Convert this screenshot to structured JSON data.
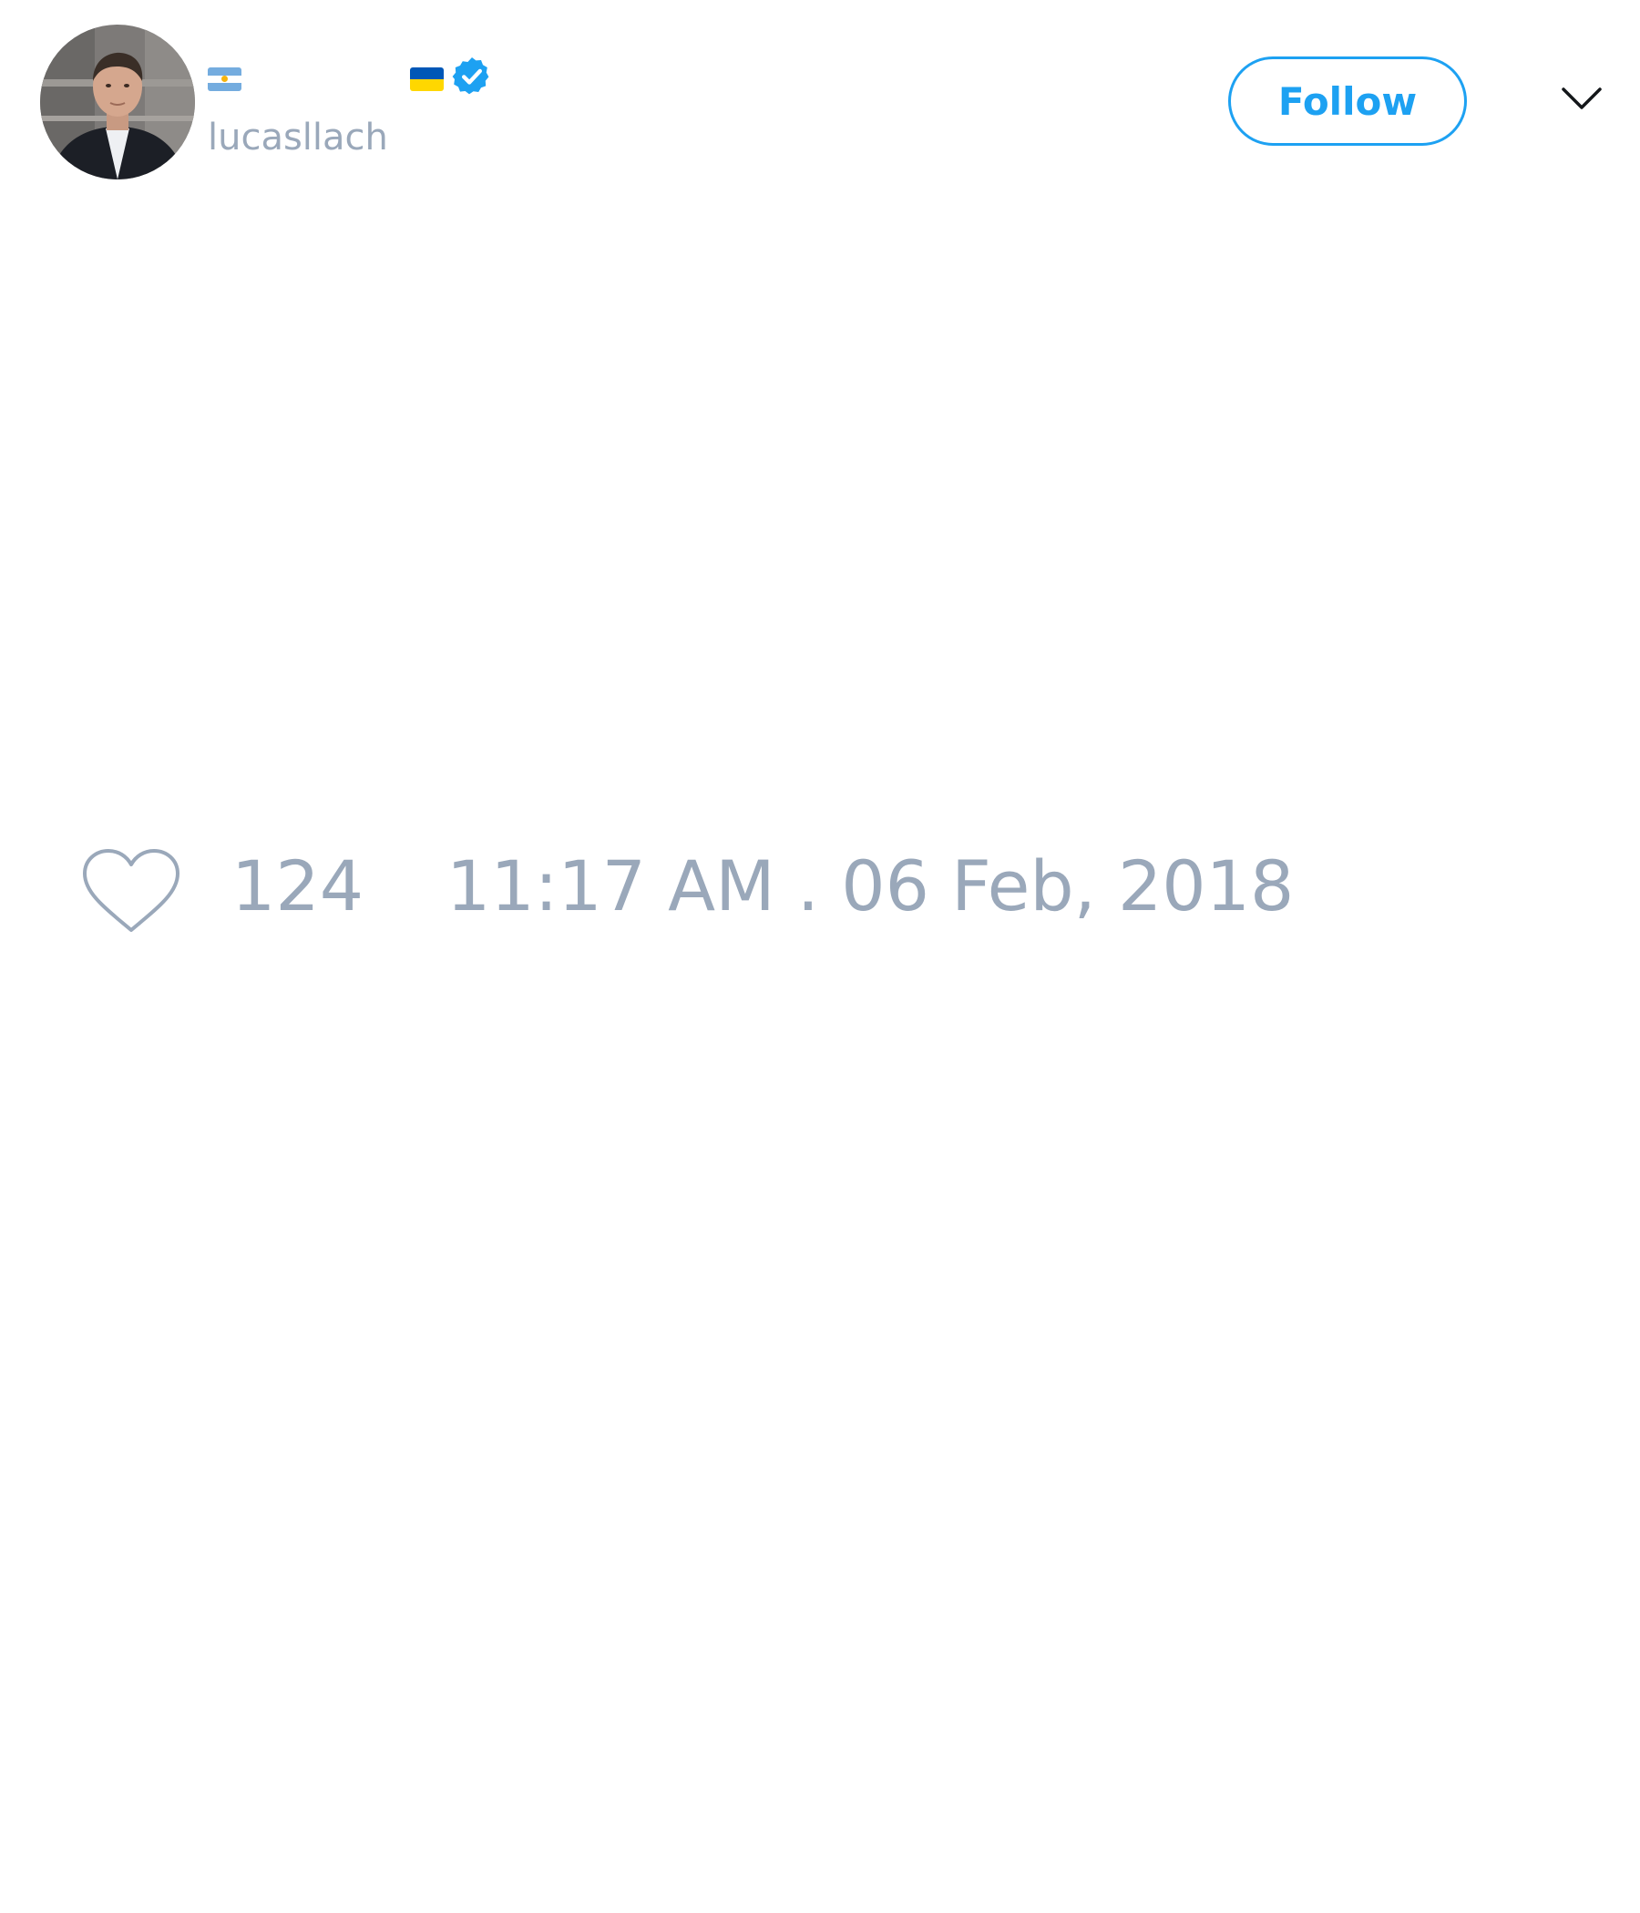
{
  "tweet": {
    "author": {
      "display_name": "",
      "handle": "lucasllach",
      "verified": true,
      "flags": [
        "argentina-flag",
        "ukraine-flag"
      ]
    },
    "follow_label": "Follow",
    "likes": "124",
    "timestamp": "11:17 AM . 06 Feb, 2018"
  },
  "colors": {
    "accent": "#1da1f2",
    "muted": "#9aa8ba",
    "background": "#ffffff"
  },
  "icons": {
    "verified": "verified-badge-icon",
    "more": "chevron-down-icon",
    "like": "heart-outline-icon"
  }
}
